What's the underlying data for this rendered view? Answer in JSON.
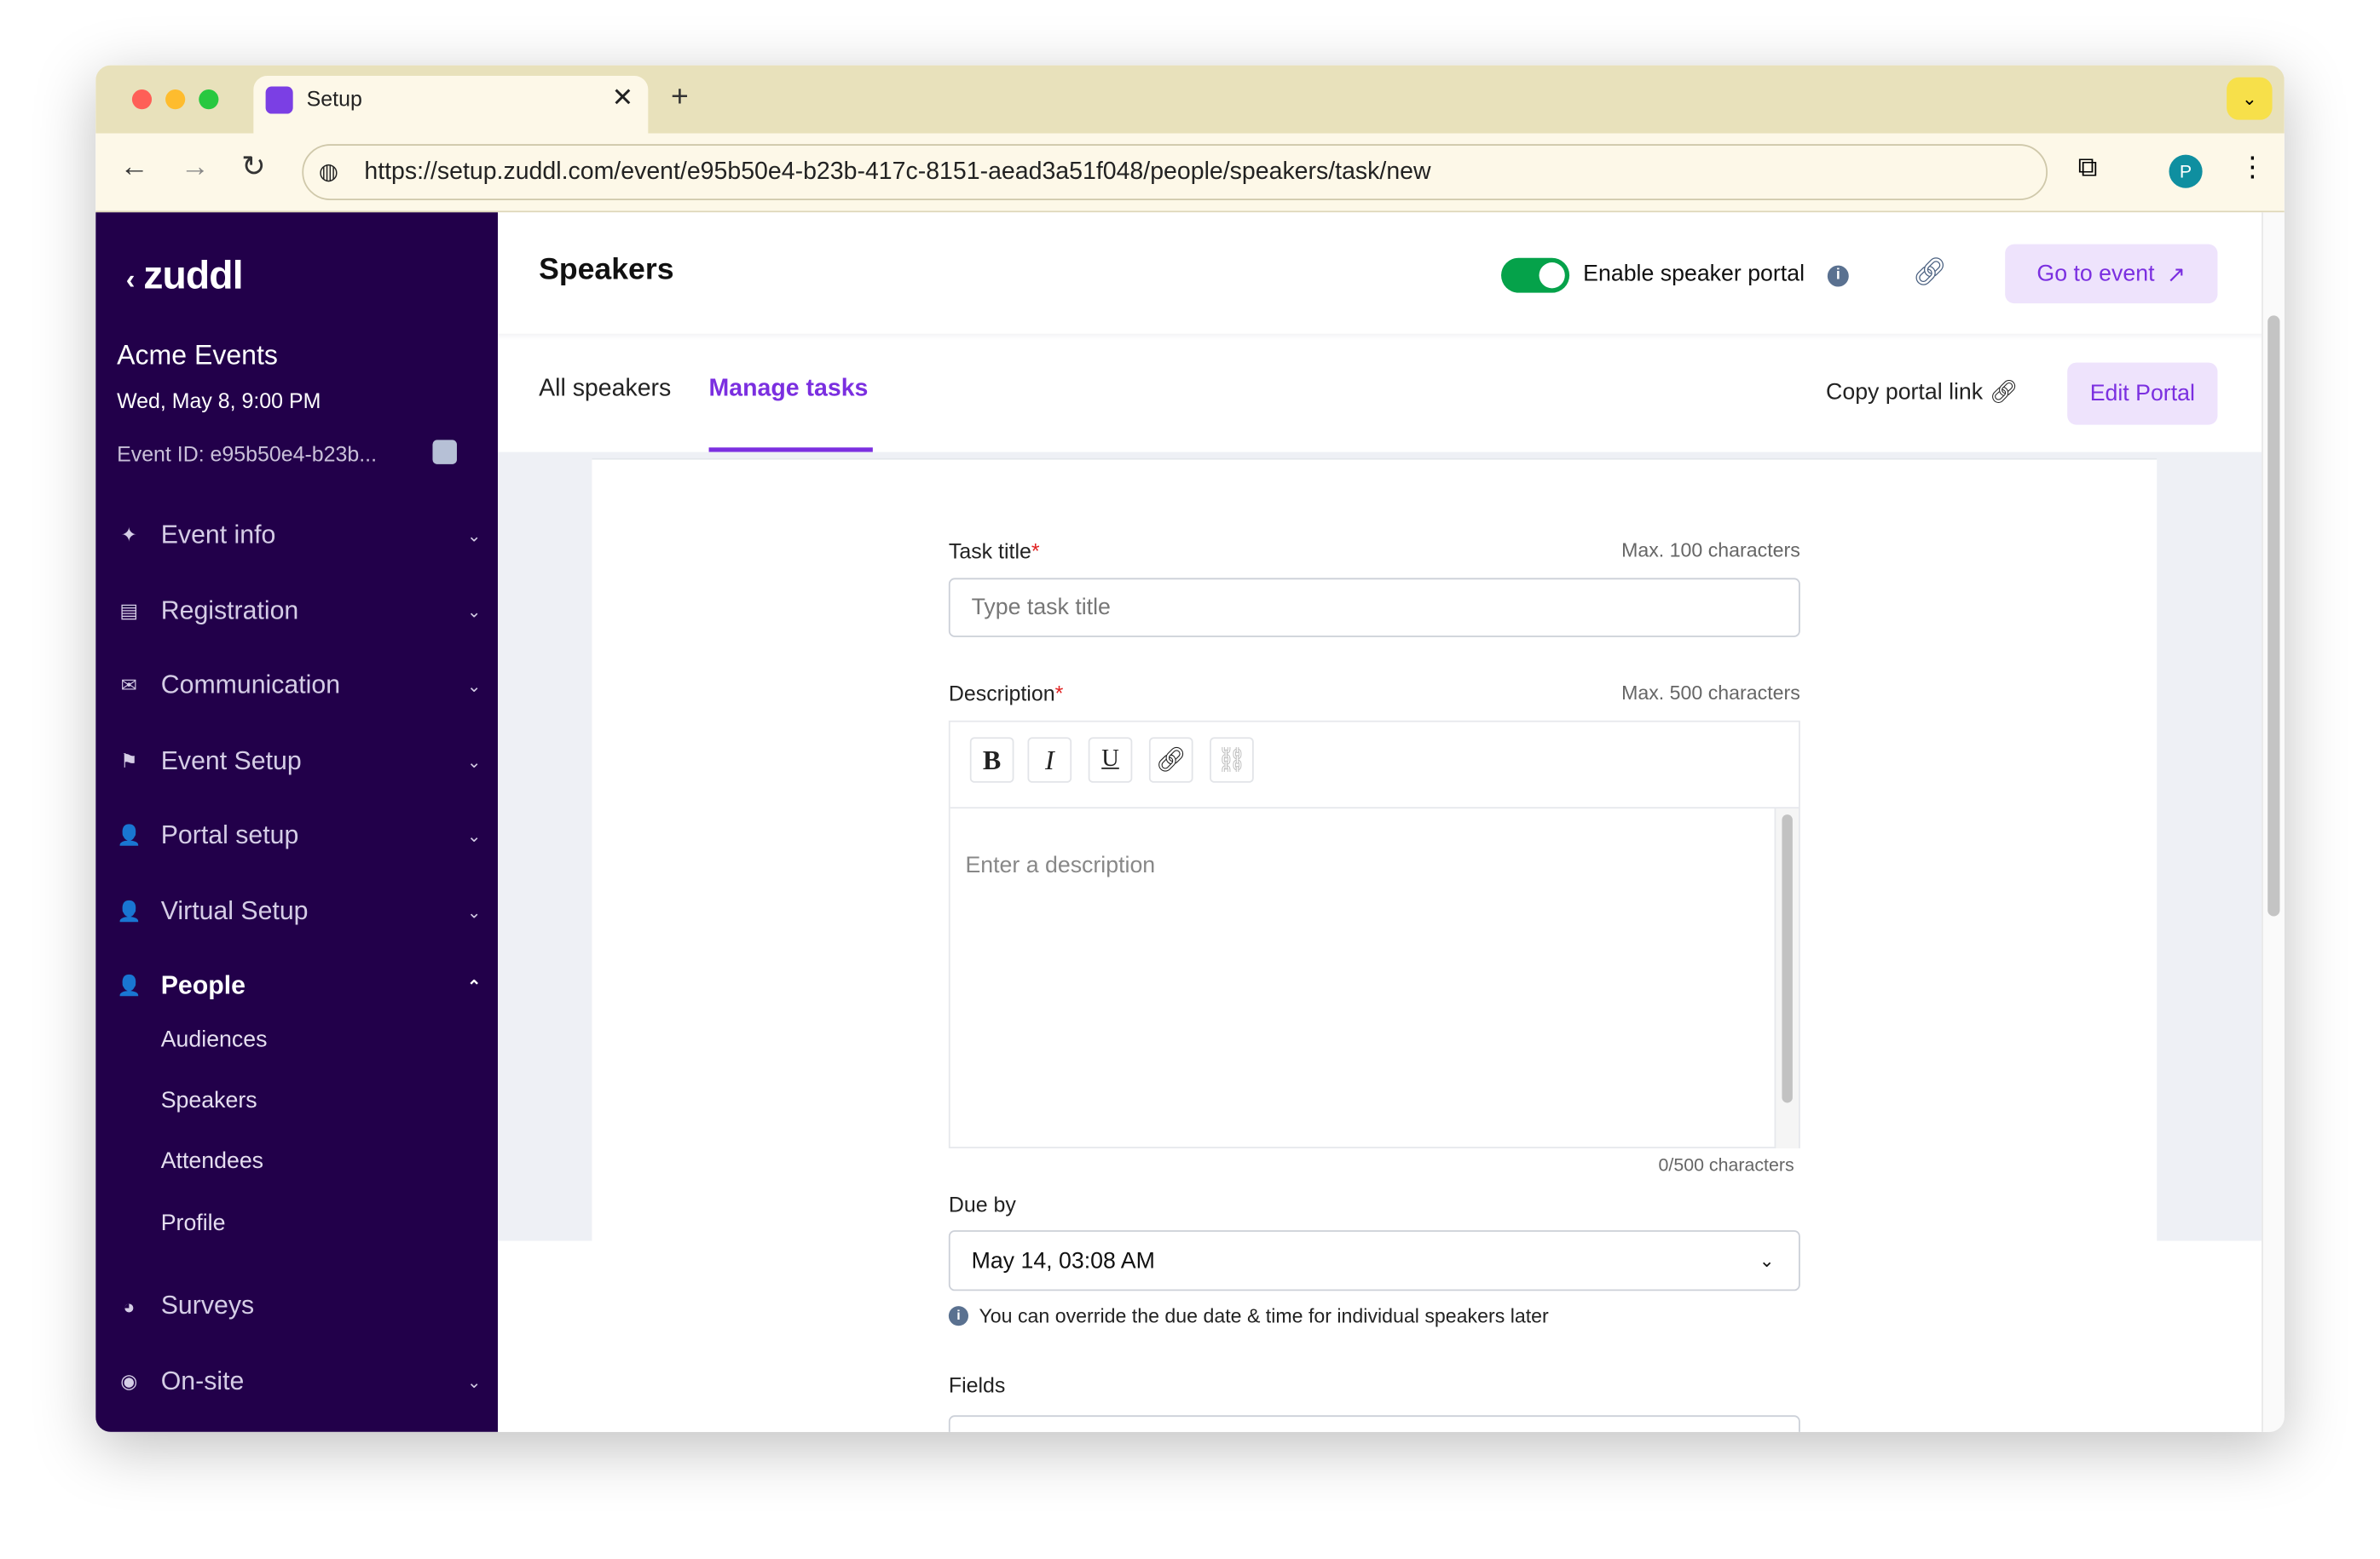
{
  "browser": {
    "tab_title": "Setup",
    "url": "https://setup.zuddl.com/event/e95b50e4-b23b-417c-8151-aead3a51f048/people/speakers/task/new",
    "profile_initial": "P"
  },
  "sidebar": {
    "logo": "zuddl",
    "org": "Acme Events",
    "date": "Wed, May 8, 9:00 PM",
    "event_id": "Event ID: e95b50e4-b23b...",
    "items": [
      {
        "label": "Event info",
        "icon": "magic-wand-icon"
      },
      {
        "label": "Registration",
        "icon": "form-icon"
      },
      {
        "label": "Communication",
        "icon": "mail-icon"
      },
      {
        "label": "Event Setup",
        "icon": "signpost-icon"
      },
      {
        "label": "Portal setup",
        "icon": "users-icon"
      },
      {
        "label": "Virtual Setup",
        "icon": "users-icon"
      },
      {
        "label": "People",
        "icon": "users-icon"
      },
      {
        "label": "Surveys",
        "icon": "pie-icon"
      },
      {
        "label": "On-site",
        "icon": "compass-icon"
      }
    ],
    "people_sub": [
      "Audiences",
      "Speakers",
      "Attendees",
      "Profile"
    ]
  },
  "header": {
    "title": "Speakers",
    "toggle_label": "Enable speaker portal",
    "toggle_on": true,
    "go_to_event": "Go to event"
  },
  "tabs": {
    "items": [
      "All speakers",
      "Manage tasks"
    ],
    "active": "Manage tasks",
    "copy_link": "Copy portal link",
    "edit_portal": "Edit Portal"
  },
  "form": {
    "task_title_label": "Task title",
    "task_title_max": "Max. 100 characters",
    "task_title_placeholder": "Type task title",
    "description_label": "Description",
    "description_max": "Max. 500 characters",
    "description_placeholder": "Enter a description",
    "char_count": "0/500 characters",
    "due_label": "Due by",
    "due_value": "May 14, 03:08 AM",
    "due_hint": "You can override the due date & time for individual speakers later",
    "fields_label": "Fields",
    "required_mark": "*"
  },
  "colors": {
    "sidebar": "#22004a",
    "accent": "#7b2fe0",
    "toggle": "#05a24a"
  }
}
